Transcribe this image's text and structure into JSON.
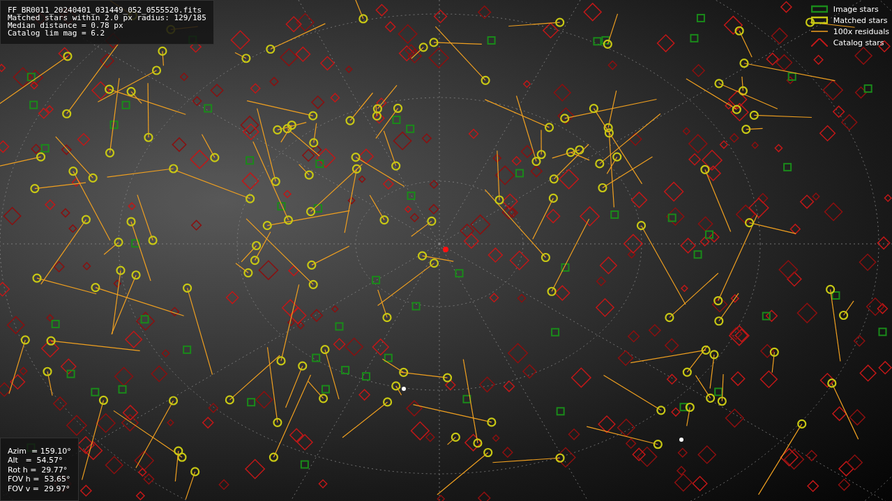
{
  "info_box": {
    "lines": [
      "FF_BR0011_20240401_031449_052_0555520.fits",
      "Matched stars within 2.0 px radius: 129/185",
      "Median distance = 0.78 px",
      "Catalog lim mag = 6.2"
    ]
  },
  "pointing_box": {
    "lines": [
      "Azim  = 159.10°",
      "Alt   =  54.57°",
      "Rot h =  29.77°",
      "FOV h =  53.65°",
      "FOV v =  29.97°"
    ]
  },
  "legend": [
    {
      "label": "Image stars",
      "kind": "image"
    },
    {
      "label": "Matched stars",
      "kind": "matched"
    },
    {
      "label": "100x residuals",
      "kind": "residual"
    },
    {
      "label": "Catalog stars",
      "kind": "catalog"
    }
  ]
}
